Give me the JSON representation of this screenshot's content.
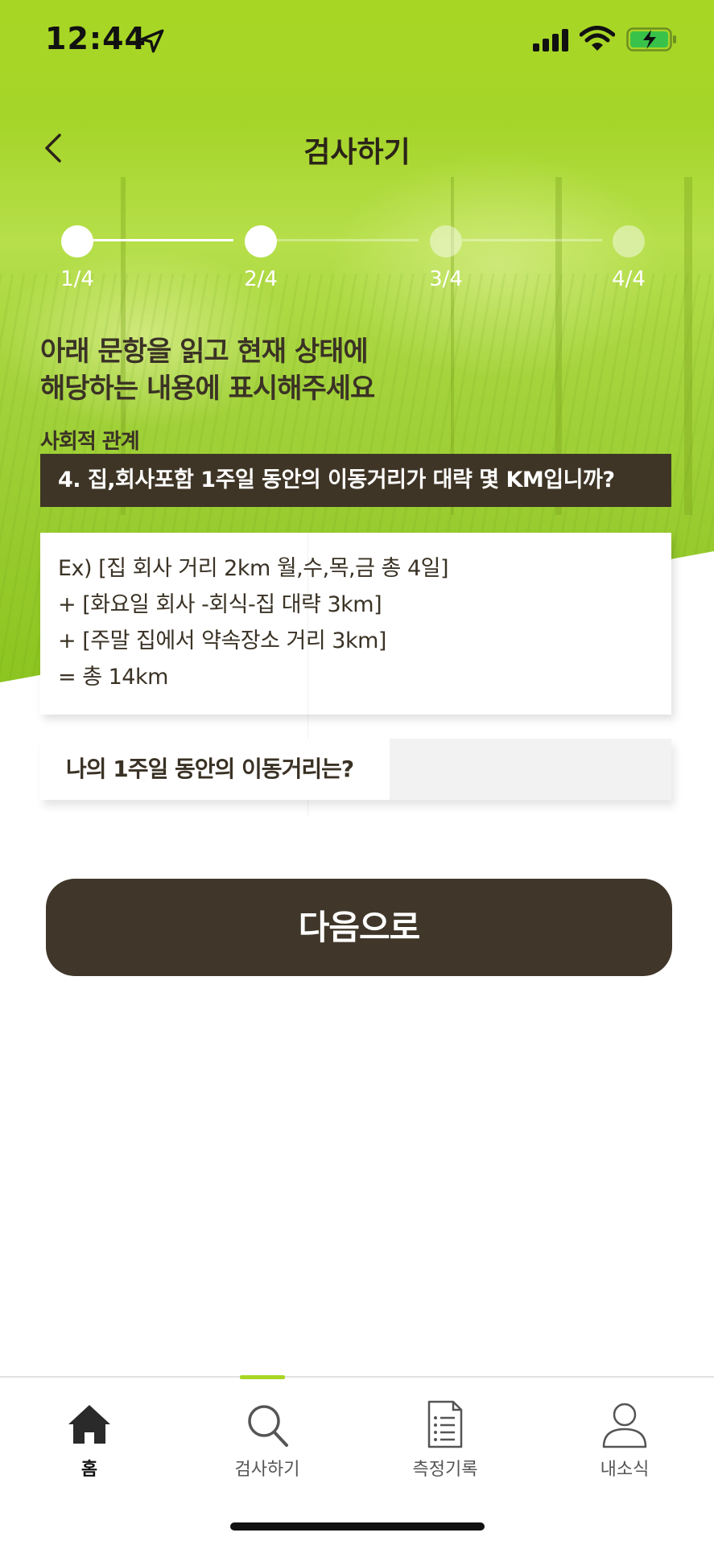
{
  "status_bar": {
    "time": "12:44"
  },
  "nav": {
    "title": "검사하기"
  },
  "stepper": {
    "steps": [
      {
        "label": "1/4",
        "state": "done"
      },
      {
        "label": "2/4",
        "state": "current"
      },
      {
        "label": "3/4",
        "state": "upcoming"
      },
      {
        "label": "4/4",
        "state": "upcoming"
      }
    ]
  },
  "content": {
    "headline_line1": "아래 문항을 읽고 현재 상태에",
    "headline_line2": "해당하는 내용에 표시해주세요",
    "category": "사회적 관계",
    "question": "4. 집,회사포함 1주일 동안의 이동거리가 대략 몇  KM입니까?",
    "example_lines": [
      "Ex) [집 회사 거리 2km 월,수,목,금 총 4일]",
      "+ [화요일 회사 -회식-집 대략 3km]",
      "+ [주말 집에서 약속장소 거리 3km]",
      "=  총 14km"
    ],
    "answer_label": "나의 1주일 동안의 이동거리는?",
    "answer_value": "",
    "answer_placeholder": ""
  },
  "next_button": {
    "label": "다음으로"
  },
  "tabbar": {
    "tabs": [
      {
        "label": "홈",
        "icon": "home-icon",
        "active": true
      },
      {
        "label": "검사하기",
        "icon": "search-icon",
        "active": false
      },
      {
        "label": "측정기록",
        "icon": "document-list-icon",
        "active": false
      },
      {
        "label": "내소식",
        "icon": "person-icon",
        "active": false
      }
    ]
  },
  "colors": {
    "accent_green": "#a8d624",
    "dark_brown": "#40372a",
    "text_brown": "#3a3225"
  }
}
